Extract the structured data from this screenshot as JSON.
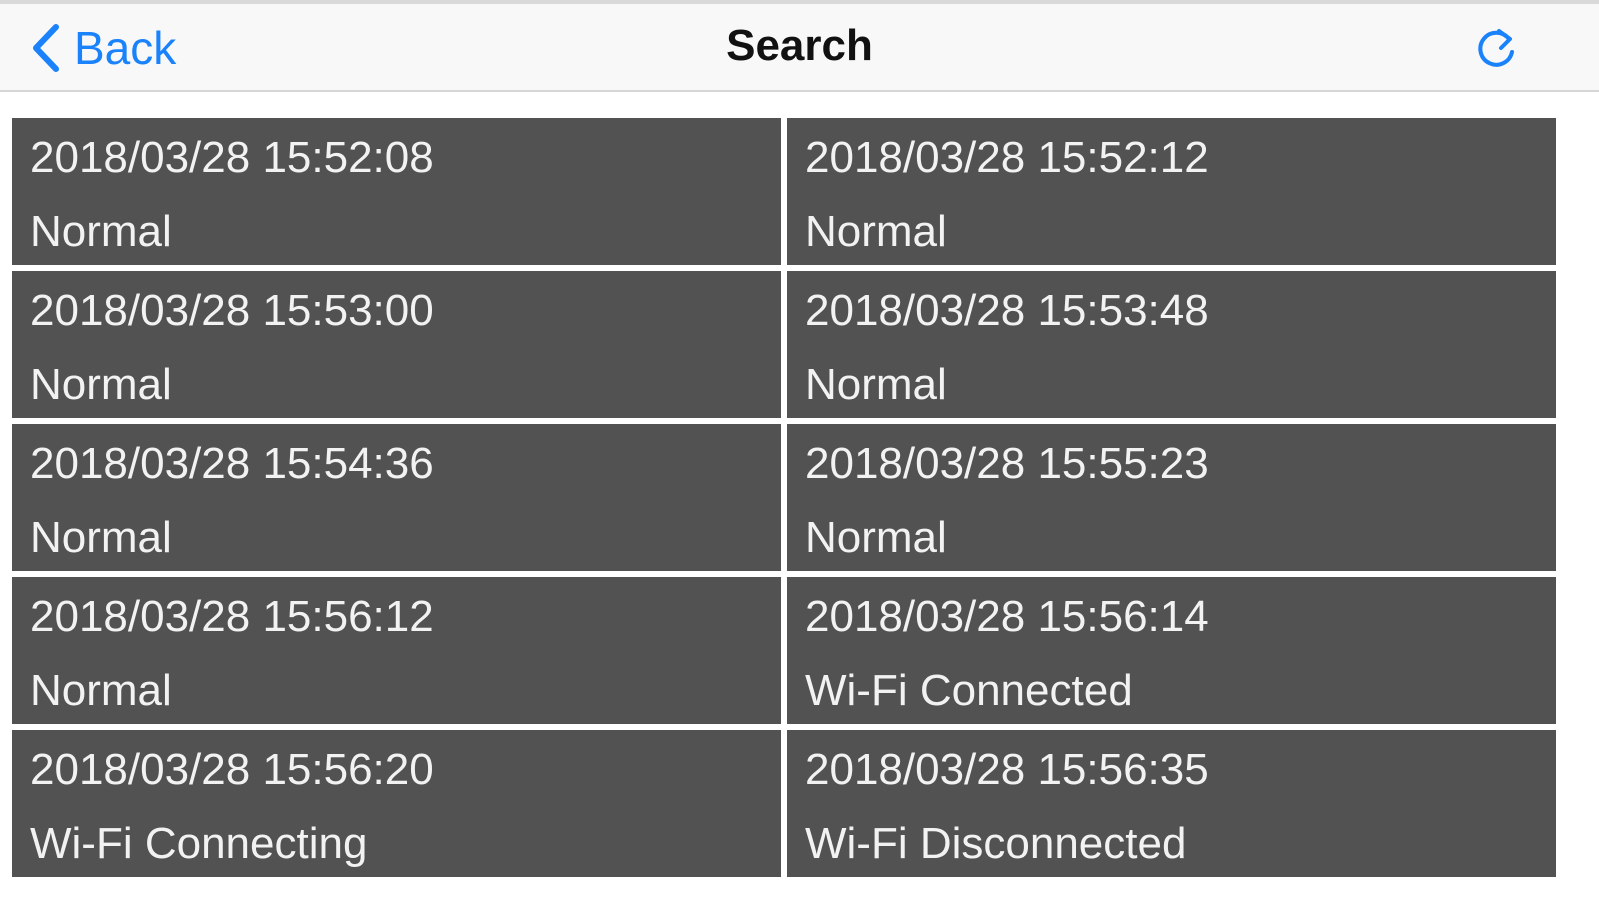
{
  "navbar": {
    "back_label": "Back",
    "title": "Search",
    "refresh_icon": "refresh-icon",
    "accent_color": "#1a82fb"
  },
  "records": [
    {
      "time": "2018/03/28 15:52:08",
      "status": "Normal"
    },
    {
      "time": "2018/03/28 15:52:12",
      "status": "Normal"
    },
    {
      "time": "2018/03/28 15:53:00",
      "status": "Normal"
    },
    {
      "time": "2018/03/28 15:53:48",
      "status": "Normal"
    },
    {
      "time": "2018/03/28 15:54:36",
      "status": "Normal"
    },
    {
      "time": "2018/03/28 15:55:23",
      "status": "Normal"
    },
    {
      "time": "2018/03/28 15:56:12",
      "status": "Normal"
    },
    {
      "time": "2018/03/28 15:56:14",
      "status": "Wi-Fi Connected"
    },
    {
      "time": "2018/03/28 15:56:20",
      "status": "Wi-Fi Connecting"
    },
    {
      "time": "2018/03/28 15:56:35",
      "status": "Wi-Fi Disconnected"
    }
  ]
}
